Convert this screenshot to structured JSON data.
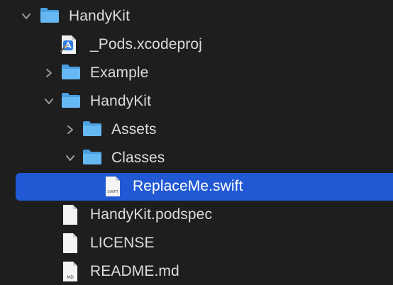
{
  "file_tree": {
    "items": [
      {
        "label": "HandyKit",
        "kind": "folder",
        "expanded": true,
        "depth": 0
      },
      {
        "label": "_Pods.xcodeproj",
        "kind": "xcodeproj",
        "depth": 1
      },
      {
        "label": "Example",
        "kind": "folder",
        "expanded": false,
        "depth": 1
      },
      {
        "label": "HandyKit",
        "kind": "folder",
        "expanded": true,
        "depth": 1
      },
      {
        "label": "Assets",
        "kind": "folder",
        "expanded": false,
        "depth": 2
      },
      {
        "label": "Classes",
        "kind": "folder",
        "expanded": true,
        "depth": 2
      },
      {
        "label": "ReplaceMe.swift",
        "kind": "swift-file",
        "selected": true,
        "depth": 3,
        "icon_caption": "SWIFT"
      },
      {
        "label": "HandyKit.podspec",
        "kind": "file",
        "depth": 1
      },
      {
        "label": "LICENSE",
        "kind": "file",
        "depth": 1
      },
      {
        "label": "README.md",
        "kind": "md-file",
        "depth": 1,
        "icon_caption": "MD"
      }
    ]
  },
  "colors": {
    "background": "#1e1e1e",
    "selection": "#2159d4",
    "folder": "#5fb4f0",
    "text": "#dcdcdc"
  }
}
